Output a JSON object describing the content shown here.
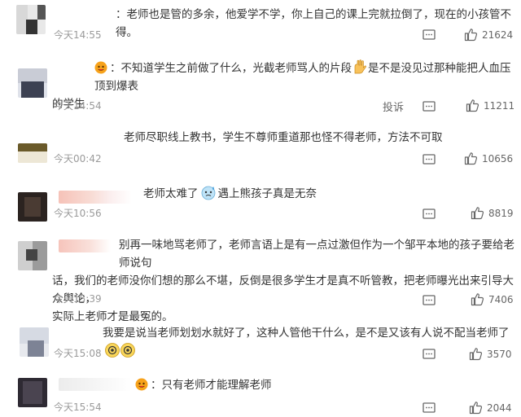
{
  "comments": [
    {
      "text": "：老师也是管的多余，他爱学不学，你上自己的课上完就拉倒了，现在的小孩管不得。",
      "time": "今天14:55",
      "likes": "21624"
    },
    {
      "text_a": "：不知道学生之前做了什么，光截老师骂人的片段",
      "text_b": "是不是没见过那种能把人血压顶到爆表",
      "text_c": "的学生",
      "time": "今天14:54",
      "report": "投诉",
      "likes": "11211"
    },
    {
      "text": "老师尽职线上教书，学生不尊师重道那也怪不得老师，方法不可取",
      "time": "今天00:42",
      "likes": "10656"
    },
    {
      "text_a": "老师太难了",
      "text_b": "遇上熊孩子真是无奈",
      "time": "今天10:56",
      "likes": "8819"
    },
    {
      "line1": "别再一味地骂老师了，老师言语上是有一点过激但作为一个邹平本地的孩子要给老师说句",
      "line2": "话，我们的老师没你们想的那么不堪，反倒是很多学生才是真不听管教，把老师曝光出来引导大众舆论，",
      "line3": "实际上老师才是最冤的。",
      "time": "今天15:39",
      "likes": "7406"
    },
    {
      "text": "我要是说当老师划划水就好了，这种人管他干什么，是不是又该有人说不配当老师了",
      "time": "今天15:08",
      "likes": "3570"
    },
    {
      "text": "：只有老师才能理解老师",
      "time": "今天15:54",
      "likes": "2044"
    }
  ],
  "icons": {
    "comment": "comment-icon",
    "like": "thumb-up-icon",
    "badge": "fan-badge-icon",
    "ok": "ok-hand-emoji",
    "sweat": "sweat-emoji",
    "dizzy": "dizzy-eyes-emoji"
  }
}
